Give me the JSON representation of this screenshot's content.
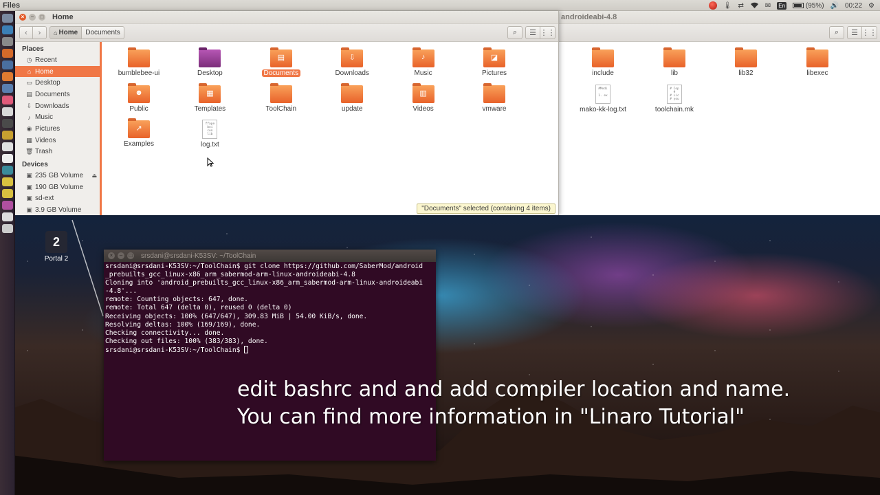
{
  "top_panel": {
    "app_name": "Files",
    "keyboard_layout": "En",
    "battery": "(95%)",
    "clock": "00:22"
  },
  "fm_back": {
    "title": "androideabi-4.8",
    "items": [
      {
        "label": "include",
        "type": "folder"
      },
      {
        "label": "lib",
        "type": "folder"
      },
      {
        "label": "lib32",
        "type": "folder"
      },
      {
        "label": "libexec",
        "type": "folder"
      },
      {
        "label": "mako-kk-log.txt",
        "type": "text",
        "preview": "#Modi\n\n1. ex"
      },
      {
        "label": "toolchain.mk",
        "type": "text",
        "preview": "# Cop\n#\n# Lic\n# you"
      }
    ]
  },
  "fm_front": {
    "title": "Home",
    "breadcrumb": {
      "home": "Home",
      "current": "Documents"
    },
    "sidebar": {
      "places_heading": "Places",
      "places": [
        {
          "label": "Recent",
          "icon": "clock-icon"
        },
        {
          "label": "Home",
          "icon": "home-icon",
          "selected": true
        },
        {
          "label": "Desktop",
          "icon": "desktop-icon"
        },
        {
          "label": "Documents",
          "icon": "documents-icon"
        },
        {
          "label": "Downloads",
          "icon": "download-icon"
        },
        {
          "label": "Music",
          "icon": "music-icon"
        },
        {
          "label": "Pictures",
          "icon": "camera-icon"
        },
        {
          "label": "Videos",
          "icon": "film-icon"
        },
        {
          "label": "Trash",
          "icon": "trash-icon"
        }
      ],
      "devices_heading": "Devices",
      "devices": [
        {
          "label": "235 GB Volume",
          "icon": "drive-icon",
          "eject": true
        },
        {
          "label": "190 GB Volume",
          "icon": "drive-icon"
        },
        {
          "label": "sd-ext",
          "icon": "drive-icon"
        },
        {
          "label": "3.9 GB Volume",
          "icon": "drive-icon"
        }
      ]
    },
    "items": [
      {
        "label": "bumblebee-ui",
        "type": "folder"
      },
      {
        "label": "Desktop",
        "type": "desktop"
      },
      {
        "label": "Documents",
        "type": "folder-docs",
        "selected": true
      },
      {
        "label": "Downloads",
        "type": "folder-down"
      },
      {
        "label": "Music",
        "type": "folder-music"
      },
      {
        "label": "Pictures",
        "type": "folder-pics"
      },
      {
        "label": "Public",
        "type": "folder-public"
      },
      {
        "label": "Templates",
        "type": "folder-templates"
      },
      {
        "label": "ToolChain",
        "type": "folder"
      },
      {
        "label": "update",
        "type": "folder"
      },
      {
        "label": "Videos",
        "type": "folder-videos"
      },
      {
        "label": "vmware",
        "type": "folder"
      },
      {
        "label": "Examples",
        "type": "folder-link"
      },
      {
        "label": "log.txt",
        "type": "text",
        "preview": "ffape\nboi\ncon\nlib"
      }
    ],
    "status": "\"Documents\" selected  (containing 4 items)"
  },
  "desktop_icon": {
    "label": "Portal 2",
    "glyph": "2"
  },
  "terminal": {
    "title": "srsdani@srsdani-K53SV: ~/ToolChain",
    "lines": [
      "srsdani@srsdani-K53SV:~/ToolChain$ git clone https://github.com/SaberMod/android",
      "_prebuilts_gcc_linux-x86_arm_sabermod-arm-linux-androideabi-4.8",
      "Cloning into 'android_prebuilts_gcc_linux-x86_arm_sabermod-arm-linux-androideabi",
      "-4.8'...",
      "remote: Counting objects: 647, done.",
      "remote: Total 647 (delta 0), reused 0 (delta 0)",
      "Receiving objects: 100% (647/647), 309.83 MiB | 54.00 KiB/s, done.",
      "Resolving deltas: 100% (169/169), done.",
      "Checking connectivity... done.",
      "Checking out files: 100% (383/383), done.",
      "srsdani@srsdani-K53SV:~/ToolChain$ "
    ]
  },
  "caption": {
    "line1": "edit bashrc and and add compiler location and name.",
    "line2": "You can find more information in \"Linaro Tutorial\""
  },
  "colors": {
    "accent": "#f07746",
    "terminal_bg": "#300a24",
    "launcher_bg": "#2b2230"
  }
}
